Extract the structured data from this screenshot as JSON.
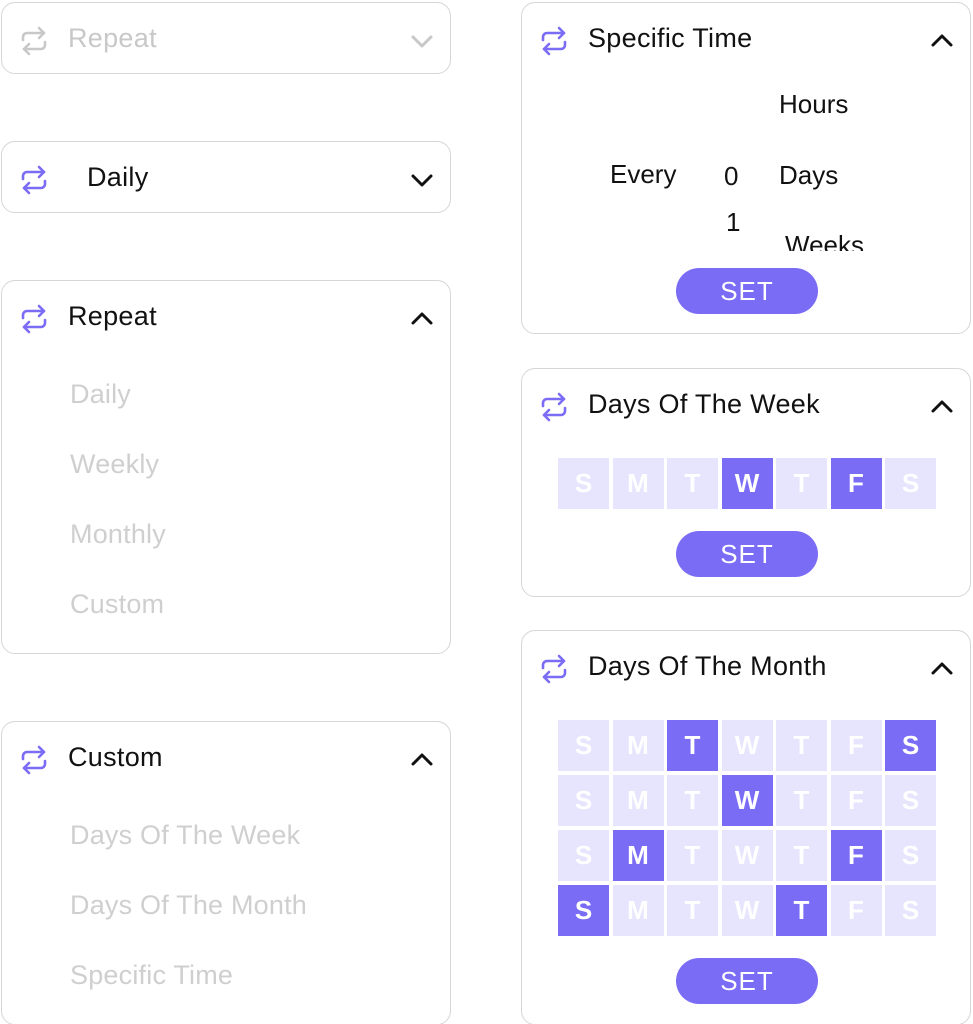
{
  "colors": {
    "accent": "#7b6cf6",
    "accent_light": "#e7e5fd",
    "border": "#d6d6d6",
    "muted_text": "#c8c8c8"
  },
  "repeat_collapsed": {
    "label": "Repeat",
    "icon": "repeat-icon",
    "chevron": "chevron-down-icon"
  },
  "daily_collapsed": {
    "label": "Daily",
    "icon": "repeat-icon",
    "chevron": "chevron-down-icon"
  },
  "repeat_open": {
    "label": "Repeat",
    "icon": "repeat-icon",
    "chevron": "chevron-up-icon",
    "options": [
      "Daily",
      "Weekly",
      "Monthly",
      "Custom"
    ]
  },
  "custom_open": {
    "label": "Custom",
    "icon": "repeat-icon",
    "chevron": "chevron-up-icon",
    "options": [
      "Days Of The Week",
      "Days Of The Month",
      "Specific Time"
    ]
  },
  "specific_time": {
    "label": "Specific Time",
    "icon": "repeat-icon",
    "chevron": "chevron-up-icon",
    "every_label": "Every",
    "number_wheel": [
      "0",
      "1"
    ],
    "unit_wheel": [
      "Hours",
      "Days",
      "Weeks"
    ],
    "set_label": "SET"
  },
  "days_of_week": {
    "label": "Days Of The Week",
    "icon": "repeat-icon",
    "chevron": "chevron-up-icon",
    "days": [
      {
        "letter": "S",
        "selected": false
      },
      {
        "letter": "M",
        "selected": false
      },
      {
        "letter": "T",
        "selected": false
      },
      {
        "letter": "W",
        "selected": true
      },
      {
        "letter": "T",
        "selected": false
      },
      {
        "letter": "F",
        "selected": true
      },
      {
        "letter": "S",
        "selected": false
      }
    ],
    "set_label": "SET"
  },
  "days_of_month": {
    "label": "Days Of The Month",
    "icon": "repeat-icon",
    "chevron": "chevron-up-icon",
    "letters": [
      "S",
      "M",
      "T",
      "W",
      "T",
      "F",
      "S"
    ],
    "selected": [
      [
        false,
        false,
        true,
        false,
        false,
        false,
        true
      ],
      [
        false,
        false,
        false,
        true,
        false,
        false,
        false
      ],
      [
        false,
        true,
        false,
        false,
        false,
        true,
        false
      ],
      [
        true,
        false,
        false,
        false,
        true,
        false,
        false
      ]
    ],
    "set_label": "SET"
  }
}
